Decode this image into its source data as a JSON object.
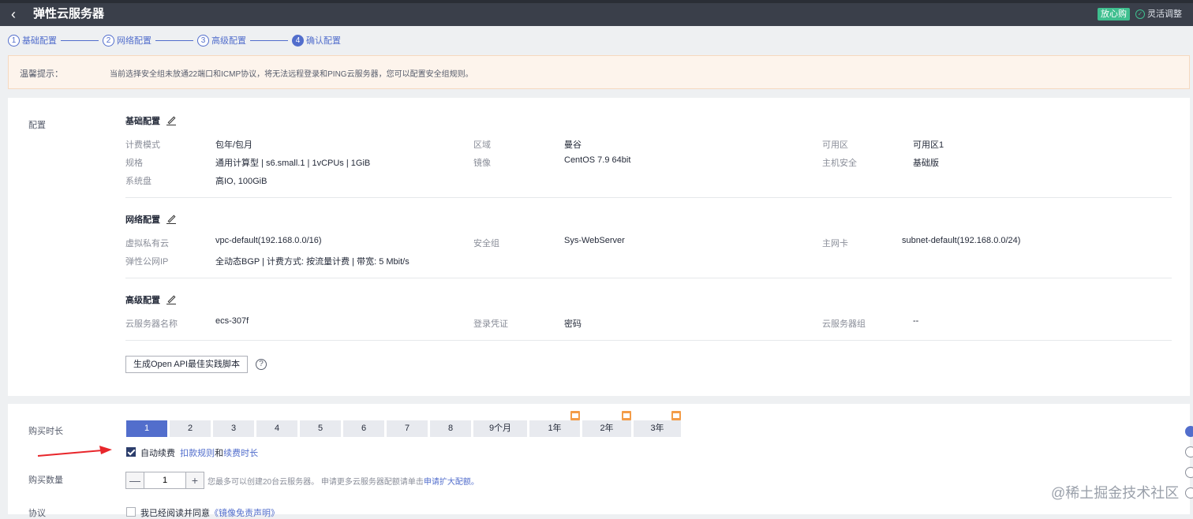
{
  "header": {
    "title": "弹性云服务器",
    "badge": "放心购",
    "flex_adjust": "灵活调整"
  },
  "steps": [
    {
      "num": "1",
      "label": "基础配置"
    },
    {
      "num": "2",
      "label": "网络配置"
    },
    {
      "num": "3",
      "label": "高级配置"
    },
    {
      "num": "4",
      "label": "确认配置"
    }
  ],
  "notice": {
    "label": "温馨提示：",
    "text": "当前选择安全组未放通22端口和ICMP协议，将无法远程登录和PING云服务器，您可以配置安全组规则。"
  },
  "config": {
    "section_label": "配置",
    "basic": {
      "title": "基础配置",
      "billing_label": "计费模式",
      "billing_value": "包年/包月",
      "region_label": "区域",
      "region_value": "曼谷",
      "az_label": "可用区",
      "az_value": "可用区1",
      "spec_label": "规格",
      "spec_value": "通用计算型 | s6.small.1 | 1vCPUs | 1GiB",
      "image_label": "镜像",
      "image_value": "CentOS 7.9 64bit",
      "security_label": "主机安全",
      "security_value": "基础版",
      "disk_label": "系统盘",
      "disk_value": "高IO, 100GiB"
    },
    "network": {
      "title": "网络配置",
      "vpc_label": "虚拟私有云",
      "vpc_value": "vpc-default(192.168.0.0/16)",
      "sg_label": "安全组",
      "sg_value": "Sys-WebServer",
      "nic_label": "主网卡",
      "nic_value": "subnet-default(192.168.0.0/24)",
      "eip_label": "弹性公网IP",
      "eip_value": "全动态BGP | 计费方式: 按流量计费 | 带宽: 5 Mbit/s"
    },
    "advanced": {
      "title": "高级配置",
      "name_label": "云服务器名称",
      "name_value": "ecs-307f",
      "cred_label": "登录凭证",
      "cred_value": "密码",
      "group_label": "云服务器组",
      "group_value": "--"
    },
    "api_button": "生成Open API最佳实践脚本",
    "help": "?"
  },
  "purchase": {
    "duration_label": "购买时长",
    "durations": [
      "1",
      "2",
      "3",
      "4",
      "5",
      "6",
      "7",
      "8",
      "9个月",
      "1年",
      "2年",
      "3年"
    ],
    "auto_renew": "自动续费",
    "deduct_rule": "扣款规则",
    "and": "和",
    "renew_period": "续费时长",
    "quantity_label": "购买数量",
    "quantity_value": "1",
    "minus": "—",
    "plus": "+",
    "quota_text": "您最多可以创建20台云服务器。 申请更多云服务器配额请单击",
    "quota_link": "申请扩大配额。",
    "agreement_label": "协议",
    "agreement_text": "我已经阅读并同意",
    "agreement_link": "《镜像免责声明》"
  },
  "watermark": "@稀土掘金技术社区"
}
